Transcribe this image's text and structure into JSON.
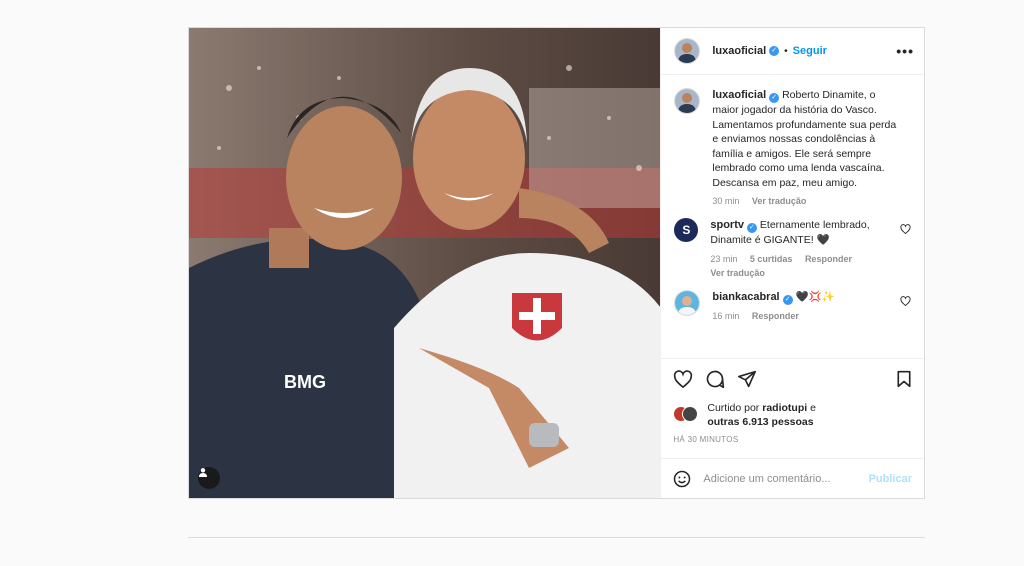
{
  "post": {
    "username": "luxaoficial",
    "follow_label": "Seguir",
    "more_label": "•••",
    "dot": "•",
    "verified_mark": "✓",
    "caption_username": "luxaoficial",
    "caption": "Roberto Dinamite, o maior jogador da história do Vasco. Lamentamos profundamente sua perda e enviamos nossas condolências à família e amigos. Ele será sempre lembrado como uma lenda vascaína. Descansa em paz, meu amigo.",
    "caption_time": "30 min",
    "caption_translate": "Ver tradução",
    "comments": [
      {
        "username": "sportv",
        "text": "Eternamente lembrado, Dinamite é GIGANTE! 🖤",
        "time": "23 min",
        "likes": "5 curtidas",
        "reply": "Responder",
        "translate": "Ver tradução",
        "avatar_letter": "S"
      },
      {
        "username": "biankacabral",
        "text": "🖤💢✨",
        "time": "16 min",
        "reply": "Responder"
      }
    ],
    "liked_by_prefix": "Curtido por",
    "liked_by_user": "radiotupi",
    "liked_by_and": "e",
    "liked_by_others": "outras 6.913 pessoas",
    "timestamp": "HÁ 30 MINUTOS",
    "comment_placeholder": "Adicione um comentário...",
    "publish_label": "Publicar"
  },
  "icons": {
    "heart": "heart-icon",
    "comment": "comment-icon",
    "share": "share-icon",
    "save": "bookmark-icon",
    "emoji": "emoji-icon",
    "user_tag": "user-tag-icon"
  },
  "colors": {
    "accent": "#0095f6",
    "verified": "#3897f0",
    "publish_disabled": "#b2dffc",
    "muted": "#8e8e8e"
  }
}
